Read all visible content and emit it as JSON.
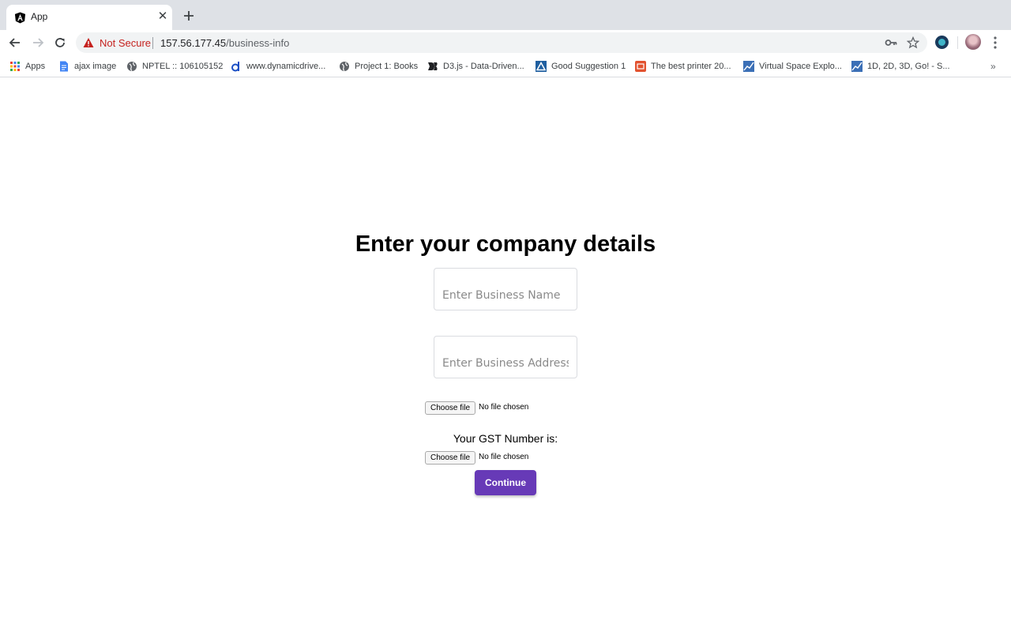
{
  "browser": {
    "tab": {
      "title": "App",
      "close_glyph": "✕"
    },
    "omnibox": {
      "security_label": "Not Secure",
      "url_host": "157.56.177.45",
      "url_path": "/business-info"
    },
    "bookmarks": [
      {
        "label": "Apps",
        "icon": "apps-grid-icon",
        "color": "#4285f4"
      },
      {
        "label": "ajax image",
        "icon": "docs-icon",
        "color": "#4285f4"
      },
      {
        "label": "NPTEL :: 106105152",
        "icon": "globe-icon",
        "color": "#5f6368"
      },
      {
        "label": "www.dynamicdrive...",
        "icon": "dynamicdrive-icon",
        "color": "#1a4fc4"
      },
      {
        "label": "Project 1: Books",
        "icon": "globe-icon",
        "color": "#5f6368"
      },
      {
        "label": "D3.js - Data-Driven...",
        "icon": "d3-icon",
        "color": "#202124"
      },
      {
        "label": "Good Suggestion 1",
        "icon": "triangle-logo-icon",
        "color": "#1f5fa0"
      },
      {
        "label": "The best printer 20...",
        "icon": "printer-site-icon",
        "color": "#e2522f"
      },
      {
        "label": "Virtual Space Explo...",
        "icon": "chart-thumb-icon",
        "color": "#3b6fb6"
      },
      {
        "label": "1D, 2D, 3D, Go! - S...",
        "icon": "chart-thumb-icon",
        "color": "#3b6fb6"
      }
    ],
    "more_glyph": "»"
  },
  "page": {
    "heading": "Enter your company details",
    "business_name_placeholder": "Enter Business Name",
    "business_address_placeholder": "Enter Business Address",
    "file_inputs": [
      {
        "button_label": "Choose file",
        "status": "No file chosen"
      },
      {
        "button_label": "Choose file",
        "status": "No file chosen"
      }
    ],
    "gst_label": "Your GST Number is:",
    "continue_label": "Continue"
  },
  "colors": {
    "accent": "#673ab7",
    "warning": "#c5221f"
  }
}
